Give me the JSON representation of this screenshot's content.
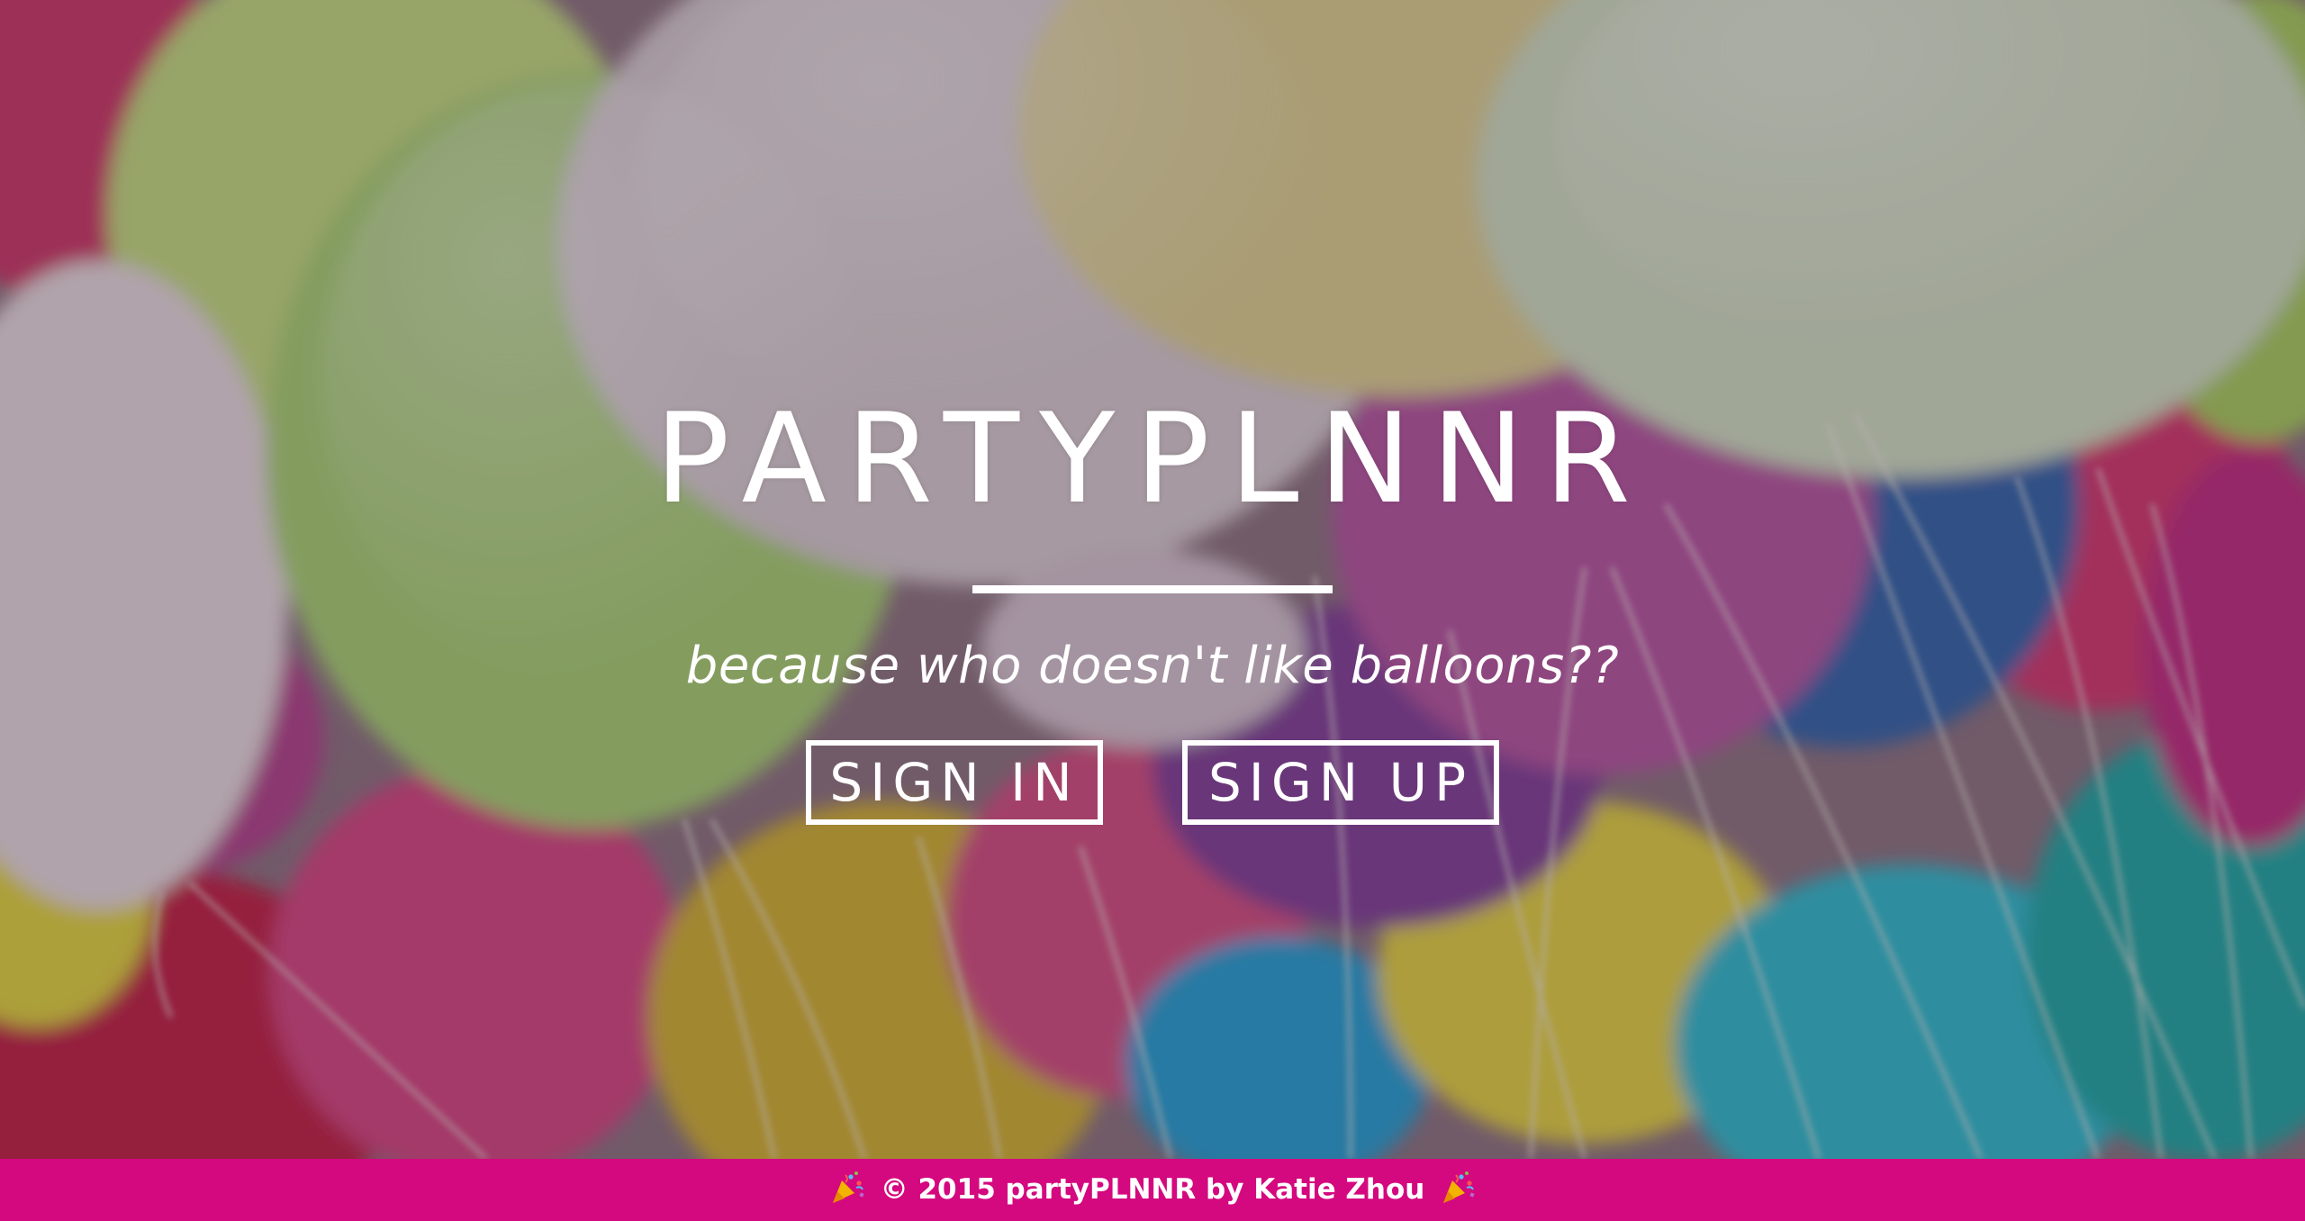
{
  "hero": {
    "title": "PARTYPLNNR",
    "tagline": "because who doesn't like balloons??",
    "background": "balloons-photo"
  },
  "auth": {
    "sign_in_label": "SIGN IN",
    "sign_up_label": "SIGN UP"
  },
  "footer": {
    "text": "© 2015 partyPLNNR by Katie Zhou",
    "icon_left": "party-popper-icon",
    "icon_right": "party-popper-icon"
  },
  "colors": {
    "footer_bg": "#d4087f",
    "text": "#ffffff"
  }
}
